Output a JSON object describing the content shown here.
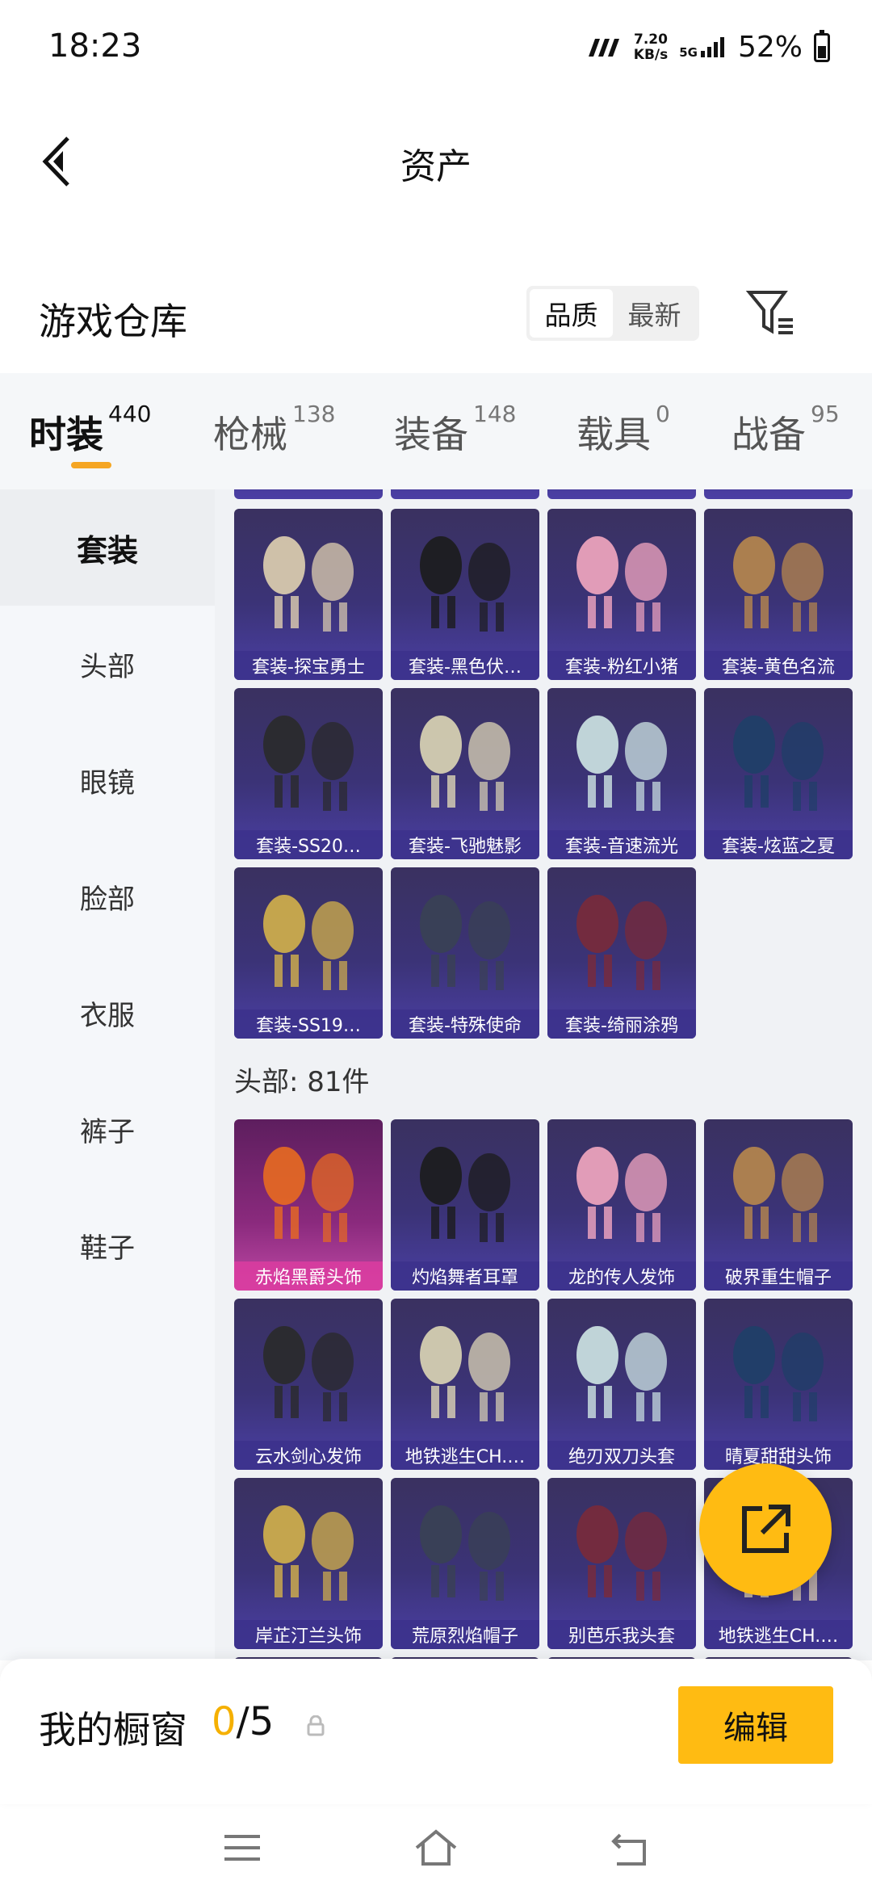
{
  "status": {
    "time": "18:23",
    "speed_value": "7.20",
    "speed_unit": "KB/s",
    "network": "5G",
    "battery": "52%"
  },
  "nav": {
    "title": "资产"
  },
  "warehouse": {
    "title": "游戏仓库",
    "sort": [
      "品质",
      "最新"
    ]
  },
  "tabs": [
    {
      "label": "时装",
      "count": "440"
    },
    {
      "label": "枪械",
      "count": "138"
    },
    {
      "label": "装备",
      "count": "148"
    },
    {
      "label": "载具",
      "count": "0"
    },
    {
      "label": "战备",
      "count": "95"
    }
  ],
  "sidebar": [
    "套装",
    "头部",
    "眼镜",
    "脸部",
    "衣服",
    "裤子",
    "鞋子"
  ],
  "suits": [
    "套装-探宝勇士",
    "套装-黑色伏…",
    "套装-粉红小猪",
    "套装-黄色名流",
    "套装-SS20…",
    "套装-飞驰魅影",
    "套装-音速流光",
    "套装-炫蓝之夏",
    "套装-SS19…",
    "套装-特殊使命",
    "套装-绮丽涂鸦"
  ],
  "head_section": {
    "title": "头部: 81件"
  },
  "heads": [
    "赤焰黑爵头饰",
    "灼焰舞者耳罩",
    "龙的传人发饰",
    "破界重生帽子",
    "云水剑心发饰",
    "地铁逃生CH.…",
    "绝刃双刀头套",
    "晴夏甜甜头饰",
    "岸芷汀兰头饰",
    "荒原烈焰帽子",
    "别芭乐我头套",
    "地铁逃生CH.…"
  ],
  "showcase": {
    "label": "我的橱窗",
    "current": "0",
    "total": "/5",
    "edit": "编辑"
  }
}
